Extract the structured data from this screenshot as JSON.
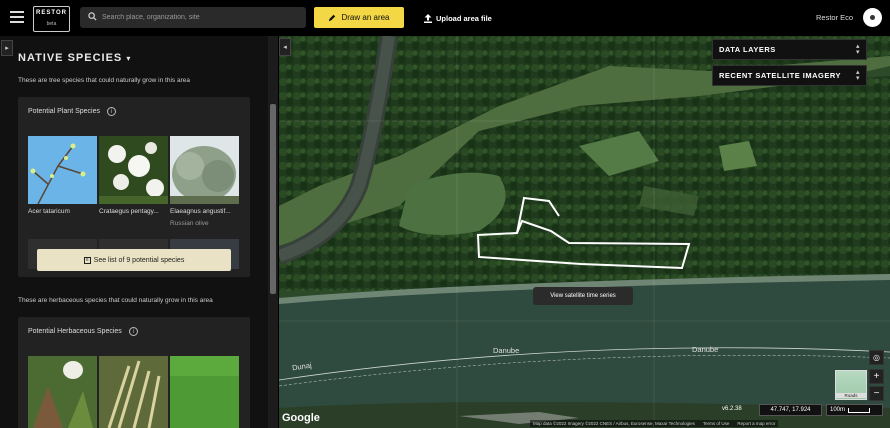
{
  "topbar": {
    "logo_wordmark": "RESTOR",
    "logo_tag": "beta",
    "search_placeholder": "Search place, organization, site",
    "draw_label": "Draw an area",
    "upload_label": "Upload area file",
    "user_name": "Restor Eco"
  },
  "sidebar": {
    "title": "NATIVE SPECIES",
    "tree_intro": "These are tree species that could naturally grow in this area",
    "plant_card_title": "Potential Plant Species",
    "plants": [
      {
        "name": "Acer tataricum",
        "common": ""
      },
      {
        "name": "Crataegus pentagy...",
        "common": ""
      },
      {
        "name": "Elaeagnus angustif...",
        "common": "Russian olive"
      }
    ],
    "see_list_label": "See list of 9 potential species",
    "herb_intro": "These are herbaceous species that could naturally grow in this area",
    "herb_card_title": "Potential Herbaceous Species"
  },
  "map": {
    "data_layers": "DATA LAYERS",
    "satellite_imagery": "RECENT SATELLITE IMAGERY",
    "tooltip": "View satellite time series",
    "river_labels": [
      "Danube",
      "Danube",
      "Dunaj"
    ],
    "basemap_label": "Roads",
    "version": "v6.2.38",
    "coordinates": "47.747, 17.924",
    "scale": "100m",
    "google": "Google",
    "attribution": [
      "Map data ©2022 Imagery ©2022 CNES / Airbus, Eurosense, Maxar Technologies",
      "Terms of Use",
      "Report a map error"
    ]
  },
  "colors": {
    "accent": "#f3d744",
    "panel": "#222222",
    "topbar": "#000000"
  }
}
